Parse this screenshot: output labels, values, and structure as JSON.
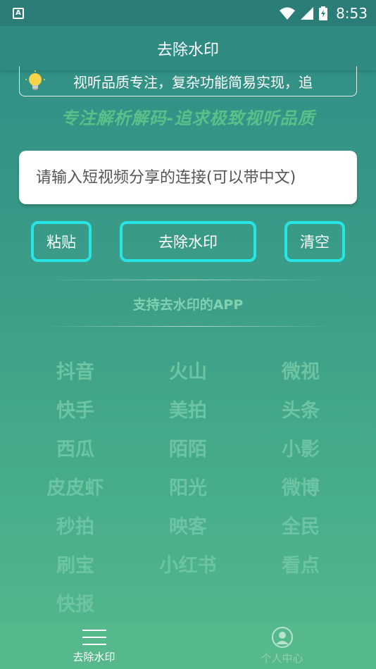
{
  "status_bar": {
    "time": "8:53"
  },
  "header": {
    "title": "去除水印"
  },
  "notice": {
    "text": "视听品质专注，复杂功能简易实现，追"
  },
  "slogan": "专注解析解码-追求极致视听品质",
  "input": {
    "placeholder": "请输入短视频分享的连接(可以带中文)",
    "value": ""
  },
  "buttons": {
    "paste": "粘贴",
    "remove": "去除水印",
    "clear": "清空"
  },
  "support": {
    "title": "支持去水印的APP",
    "apps": [
      "抖音",
      "火山",
      "微视",
      "快手",
      "美拍",
      "头条",
      "西瓜",
      "陌陌",
      "小影",
      "皮皮虾",
      "阳光",
      "微博",
      "秒拍",
      "映客",
      "全民",
      "刷宝",
      "小红书",
      "看点",
      "快报"
    ]
  },
  "bottom_nav": {
    "home": "去除水印",
    "me": "个人中心"
  },
  "colors": {
    "accent_border": "#27e5e5",
    "header": "#2f8a82",
    "app_text": "#6cc4a2"
  }
}
